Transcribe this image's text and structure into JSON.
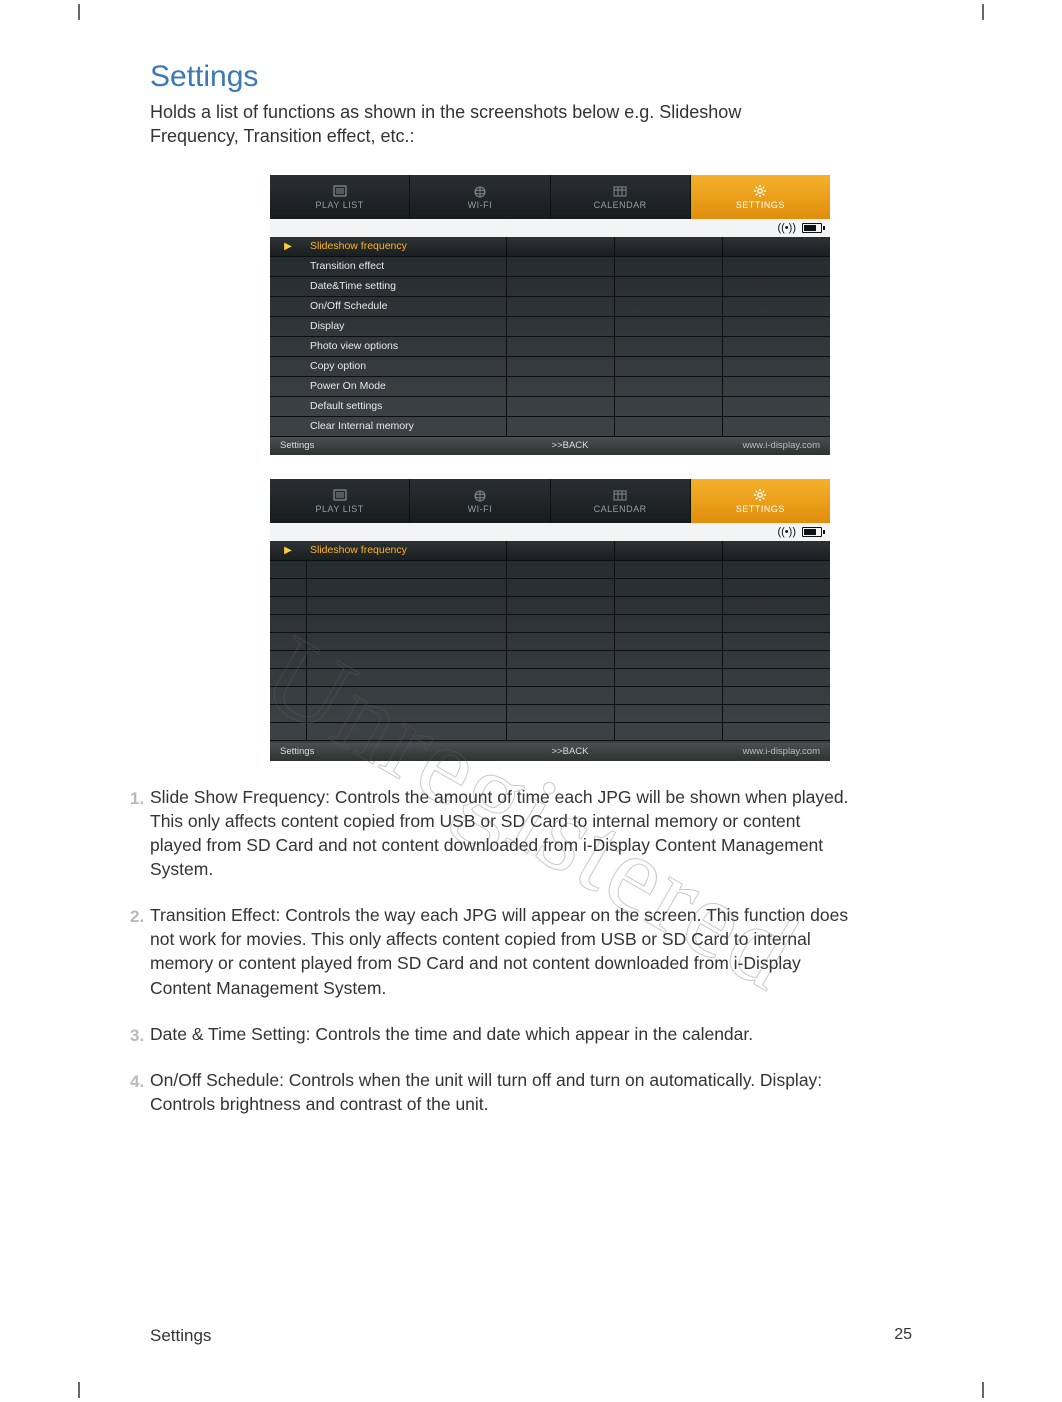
{
  "page": {
    "title": "Settings",
    "intro": "Holds a list of functions as shown in the screenshots below e.g. Slideshow Frequency, Transition effect, etc.:",
    "footer_label": "Settings",
    "page_number": "25"
  },
  "watermark": "Unregistered",
  "tabs": [
    {
      "label": "PLAY LIST",
      "icon": "playlist-icon"
    },
    {
      "label": "WI-FI",
      "icon": "wifi-icon"
    },
    {
      "label": "CALENDAR",
      "icon": "calendar-icon"
    },
    {
      "label": "SETTINGS",
      "icon": "gear-icon",
      "active": true
    }
  ],
  "screenshot1": {
    "rows": [
      "Slideshow frequency",
      "Transition effect",
      "Date&Time setting",
      "On/Off Schedule",
      "Display",
      "Photo view options",
      "Copy option",
      "Power On Mode",
      "Default settings",
      "Clear Internal memory"
    ],
    "selected_index": 0,
    "footer_left": "Settings",
    "footer_center": ">>BACK",
    "footer_right": "www.i-display.com"
  },
  "screenshot2": {
    "rows": [
      "Slideshow frequency"
    ],
    "selected_index": 0,
    "footer_left": "Settings",
    "footer_center": ">>BACK",
    "footer_right": "www.i-display.com"
  },
  "descriptions": [
    "Slide Show Frequency: Controls the amount of time each JPG will be shown when played. This only affects content copied from USB or SD Card to internal memory or content played from SD Card and not content downloaded from i-Display Content Management System.",
    "Transition Effect: Controls the way each JPG will appear on the screen. This function does not work for movies. This only affects content copied from USB or SD Card to internal memory or content played from SD Card and not content downloaded from i-Display Content Management System.",
    "Date & Time Setting: Controls the time and date which appear in the calendar.",
    "On/Off Schedule: Controls when the unit will turn off and turn on automatically. Display: Controls brightness and contrast of the unit."
  ]
}
